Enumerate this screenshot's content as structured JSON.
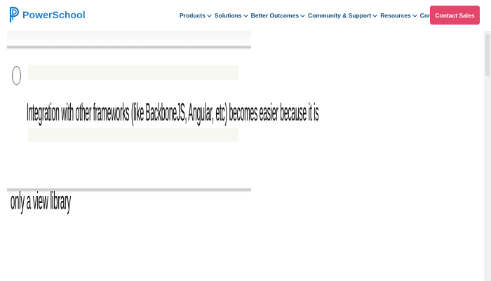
{
  "header": {
    "brand": "PowerSchool",
    "logo_color": "#1f7cc4",
    "nav": [
      {
        "label": "Products",
        "icon": "chevron-down-icon"
      },
      {
        "label": "Solutions",
        "icon": "chevron-down-icon"
      },
      {
        "label": "Better Outcomes",
        "icon": "chevron-down-icon"
      },
      {
        "label": "Community & Support",
        "icon": "chevron-down-icon"
      },
      {
        "label": "Resources",
        "icon": "chevron-down-icon"
      },
      {
        "label": "Company",
        "icon": "chevron-down-icon"
      }
    ],
    "nav_color": "#0b4a7a",
    "cta_label": "Contact Sales",
    "cta_color": "#e4456b"
  },
  "slide": {
    "bullet_icon": "radio-circle-icon",
    "lines": [
      "Integration with other frameworks (like BackboneJS, Angular, etc) becomes easier because it is",
      "only a view library"
    ]
  }
}
